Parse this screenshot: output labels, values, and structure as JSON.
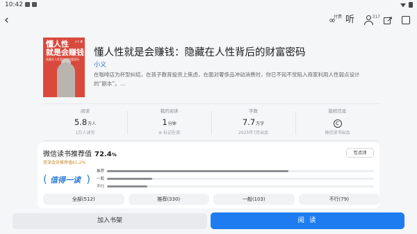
{
  "status_bar": {
    "time": "10:42"
  },
  "toolbar": {
    "audio_badge": "付费",
    "listen_label": "听",
    "friends_count": "317"
  },
  "book": {
    "cover_title": "懂人性\n就是会赚钱",
    "cover_subtitle": "隐藏在人性背后的财富密码",
    "cover_author": "小义 著",
    "title": "懂人性就是会赚钱：隐藏在人性背后的财富密码",
    "author": "小义",
    "description": "在咖啡店为杯型纠结，在孩子教育投资上焦虑，在面对奢侈品冲动消费时，你已不知不觉陷入商家利用人性弱点设计的“剧本”。…"
  },
  "stats": [
    {
      "label": "阅读",
      "value": "5.8",
      "unit": "万人",
      "sub": "1万人读完"
    },
    {
      "label": "我的阅读",
      "value": "1",
      "unit": "分钟",
      "sub": "⊕ 标记在读"
    },
    {
      "label": "字数",
      "value": "7.7",
      "unit": "万字",
      "sub": "2025年7月出品"
    },
    {
      "label": "版权信息",
      "value": "",
      "unit": "",
      "sub": "微信读书出品"
    }
  ],
  "rating": {
    "title": "微信读书推荐值",
    "percent": "72.4",
    "percent_sign": "%",
    "senior_label": "资深会员推荐值61.2%",
    "write_review": "写点评",
    "badge_text": "值得一读",
    "bars": [
      {
        "label": "推荐",
        "fraction": 0.68
      },
      {
        "label": "一般",
        "fraction": 0.17
      },
      {
        "label": "不行",
        "fraction": 0.15
      }
    ]
  },
  "filters": [
    "全部(512)",
    "推荐(330)",
    "一般(103)",
    "不行(79)"
  ],
  "actions": {
    "add_shelf": "加入书架",
    "read": "阅 读"
  },
  "colors": {
    "accent": "#1e7cf0",
    "link": "#2f6fd6",
    "cover": "#d94a3d",
    "badge": "#2f7fd6",
    "senior": "#c58a2a"
  }
}
